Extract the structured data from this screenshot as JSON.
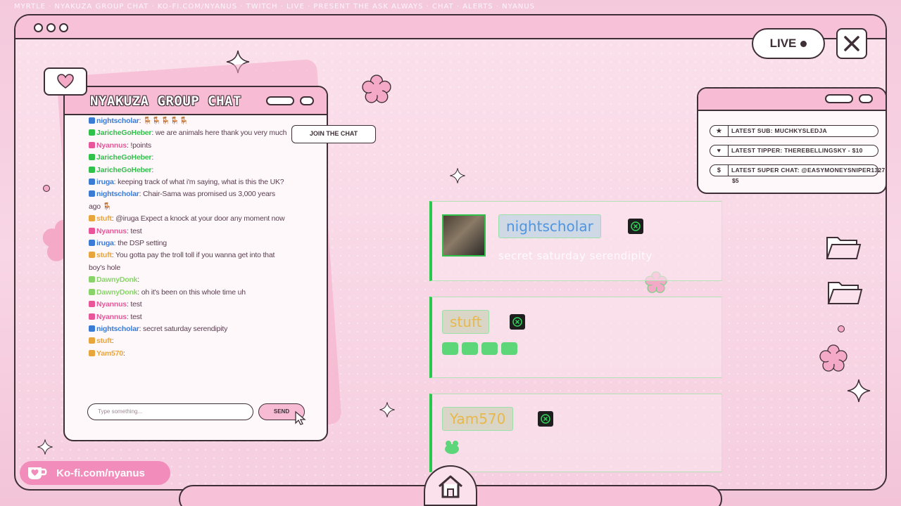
{
  "ticker": "MYRTLE · NYAKUZA GROUP CHAT · KO-FI.COM/NYANUS · TWITCH · LIVE · PRESENT THE ASK ALWAYS · CHAT · ALERTS · NYANUS",
  "header": {
    "live_label": "LIVE"
  },
  "chat": {
    "title": "NYAKUZA GROUP CHAT",
    "join_label": "JOIN THE CHAT",
    "input_placeholder": "Type something...",
    "send_label": "SEND",
    "messages": [
      {
        "user": "nightscholar",
        "text": ": 🪑🪑🪑🪑🪑",
        "color": "#3a7bd5"
      },
      {
        "user": "JaricheGoHeber",
        "text": ": we are animals here thank you very much",
        "color": "#2fc14a"
      },
      {
        "user": "Nyannus",
        "text": ": !points",
        "color": "#e8559a"
      },
      {
        "user": "JaricheGoHeber",
        "text": ":",
        "color": "#2fc14a"
      },
      {
        "user": "JaricheGoHeber",
        "text": ":",
        "color": "#2fc14a"
      },
      {
        "user": "iruga",
        "text": ": keeping track of what i'm saying, what is this the UK?",
        "color": "#3a7bd5"
      },
      {
        "user": "nightscholar",
        "text": ": Chair-Sama was promised us 3,000 years ago 🪑",
        "color": "#3a7bd5"
      },
      {
        "user": "stuft",
        "text": ": @iruga Expect a knock at your door any moment now",
        "color": "#e7a53b"
      },
      {
        "user": "Nyannus",
        "text": ": test",
        "color": "#e8559a"
      },
      {
        "user": "iruga",
        "text": ": the DSP setting",
        "color": "#3a7bd5"
      },
      {
        "user": "stuft",
        "text": ": You gotta pay the troll toll if you wanna get into that boy's hole",
        "color": "#e7a53b"
      },
      {
        "user": "DawnyDonk",
        "text": ":",
        "color": "#88d46a"
      },
      {
        "user": "DawnyDonk",
        "text": ": oh it's been on this whole time uh",
        "color": "#88d46a"
      },
      {
        "user": "Nyannus",
        "text": ": test",
        "color": "#e8559a"
      },
      {
        "user": "Nyannus",
        "text": ": test",
        "color": "#e8559a"
      },
      {
        "user": "nightscholar",
        "text": ": secret saturday serendipity",
        "color": "#3a7bd5"
      },
      {
        "user": "stuft",
        "text": ":",
        "color": "#e7a53b"
      },
      {
        "user": "Yam570",
        "text": ":",
        "color": "#e7a53b"
      }
    ]
  },
  "kofi": {
    "label": "Ko-fi.com/nyanus"
  },
  "alerts": {
    "latest_sub": "LATEST SUB: MUCHKYSLEDJA",
    "latest_tipper": "LATEST TIPPER: THEREBELLINGSKY - $10",
    "latest_superchat": "LATEST SUPER CHAT: @EASYMONEYSNIPER1327 -",
    "latest_superchat_amount": "$5"
  },
  "cards": [
    {
      "user": "nightscholar",
      "text": "secret saturday serendipity"
    },
    {
      "user": "stuft",
      "text": ""
    },
    {
      "user": "Yam570",
      "text": ""
    }
  ],
  "colors": {
    "accent_pink": "#f7bcd3",
    "outline": "#3e2e36",
    "card_green": "#27c94a"
  }
}
